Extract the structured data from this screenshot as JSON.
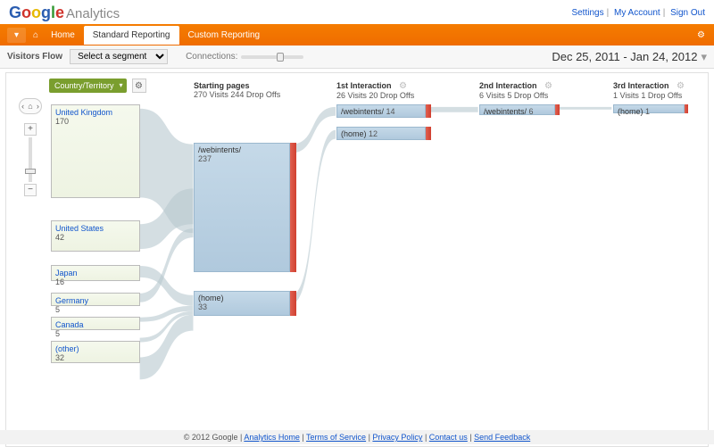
{
  "brand": {
    "google": "Google",
    "product": "Analytics"
  },
  "toplinks": {
    "settings": "Settings",
    "account": "My Account",
    "signout": "Sign Out"
  },
  "nav": {
    "home": "Home",
    "standard": "Standard Reporting",
    "custom": "Custom Reporting"
  },
  "subbar": {
    "title": "Visitors Flow",
    "segment": "Select a segment",
    "connections": "Connections:"
  },
  "daterange": {
    "from": "Dec 25, 2011",
    "to": "Jan 24, 2012"
  },
  "dimension": "Country/Territory",
  "columns": {
    "starting": {
      "title": "Starting pages",
      "sub": "270 Visits 244 Drop Offs"
    },
    "i1": {
      "title": "1st Interaction",
      "sub": "26 Visits 20 Drop Offs"
    },
    "i2": {
      "title": "2nd Interaction",
      "sub": "6 Visits 5 Drop Offs"
    },
    "i3": {
      "title": "3rd Interaction",
      "sub": "1 Visits 1 Drop Offs"
    }
  },
  "countries": [
    {
      "name": "United Kingdom",
      "value": "170"
    },
    {
      "name": "United States",
      "value": "42"
    },
    {
      "name": "Japan",
      "value": "16"
    },
    {
      "name": "Germany",
      "value": "5"
    },
    {
      "name": "Canada",
      "value": "5"
    },
    {
      "name": "(other)",
      "value": "32"
    }
  ],
  "pages": {
    "webintents": {
      "name": "/webintents/",
      "value": "237"
    },
    "home": {
      "name": "(home)",
      "value": "33"
    }
  },
  "i1nodes": {
    "a": {
      "name": "/webintents/",
      "value": "14"
    },
    "b": {
      "name": "(home)",
      "value": "12"
    }
  },
  "i2nodes": {
    "a": {
      "name": "/webintents/",
      "value": "6"
    }
  },
  "i3nodes": {
    "a": {
      "name": "(home)",
      "value": "1"
    }
  },
  "footer": {
    "copyright": "© 2012 Google",
    "links": [
      "Analytics Home",
      "Terms of Service",
      "Privacy Policy",
      "Contact us",
      "Send Feedback"
    ]
  },
  "chart_data": {
    "type": "sankey",
    "title": "Visitors Flow",
    "dimension": "Country/Territory",
    "date_range": [
      "Dec 25, 2011",
      "Jan 24, 2012"
    ],
    "stages": [
      {
        "name": "Country/Territory",
        "nodes": [
          {
            "label": "United Kingdom",
            "value": 170
          },
          {
            "label": "United States",
            "value": 42
          },
          {
            "label": "Japan",
            "value": 16
          },
          {
            "label": "Germany",
            "value": 5
          },
          {
            "label": "Canada",
            "value": 5
          },
          {
            "label": "(other)",
            "value": 32
          }
        ]
      },
      {
        "name": "Starting pages",
        "visits": 270,
        "drop_offs": 244,
        "nodes": [
          {
            "label": "/webintents/",
            "value": 237
          },
          {
            "label": "(home)",
            "value": 33
          }
        ]
      },
      {
        "name": "1st Interaction",
        "visits": 26,
        "drop_offs": 20,
        "nodes": [
          {
            "label": "/webintents/",
            "value": 14
          },
          {
            "label": "(home)",
            "value": 12
          }
        ]
      },
      {
        "name": "2nd Interaction",
        "visits": 6,
        "drop_offs": 5,
        "nodes": [
          {
            "label": "/webintents/",
            "value": 6
          }
        ]
      },
      {
        "name": "3rd Interaction",
        "visits": 1,
        "drop_offs": 1,
        "nodes": [
          {
            "label": "(home)",
            "value": 1
          }
        ]
      }
    ]
  }
}
